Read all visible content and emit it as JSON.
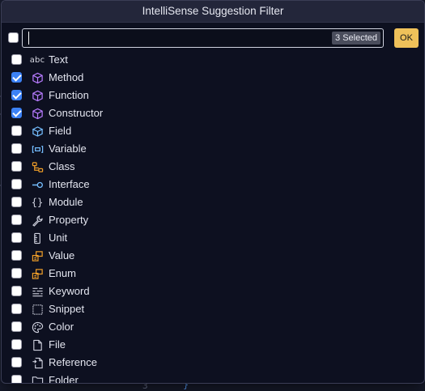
{
  "dialog": {
    "title": "IntelliSense Suggestion Filter",
    "filter_value": "",
    "selected_badge": "3 Selected",
    "ok_label": "OK",
    "select_all_checked": false
  },
  "editor_peek": {
    "line_number": "3",
    "brace": "}"
  },
  "colors": {
    "accent_ok": "#efc15a",
    "checkbox_checked": "#3c82f6",
    "method_icon": "#b77bff",
    "class_icon": "#ee9d28",
    "variable_icon": "#75beff"
  },
  "items": [
    {
      "label": "Text",
      "checked": false,
      "icon": "text-abc-icon"
    },
    {
      "label": "Method",
      "checked": true,
      "icon": "method-cube-icon"
    },
    {
      "label": "Function",
      "checked": true,
      "icon": "function-cube-icon"
    },
    {
      "label": "Constructor",
      "checked": true,
      "icon": "constructor-cube-icon"
    },
    {
      "label": "Field",
      "checked": false,
      "icon": "field-icon"
    },
    {
      "label": "Variable",
      "checked": false,
      "icon": "variable-icon"
    },
    {
      "label": "Class",
      "checked": false,
      "icon": "class-icon"
    },
    {
      "label": "Interface",
      "checked": false,
      "icon": "interface-icon"
    },
    {
      "label": "Module",
      "checked": false,
      "icon": "module-braces-icon"
    },
    {
      "label": "Property",
      "checked": false,
      "icon": "property-wrench-icon"
    },
    {
      "label": "Unit",
      "checked": false,
      "icon": "unit-ruler-icon"
    },
    {
      "label": "Value",
      "checked": false,
      "icon": "value-enum-icon"
    },
    {
      "label": "Enum",
      "checked": false,
      "icon": "enum-icon"
    },
    {
      "label": "Keyword",
      "checked": false,
      "icon": "keyword-icon"
    },
    {
      "label": "Snippet",
      "checked": false,
      "icon": "snippet-icon"
    },
    {
      "label": "Color",
      "checked": false,
      "icon": "color-palette-icon"
    },
    {
      "label": "File",
      "checked": false,
      "icon": "file-icon"
    },
    {
      "label": "Reference",
      "checked": false,
      "icon": "reference-icon"
    },
    {
      "label": "Folder",
      "checked": false,
      "icon": "folder-icon"
    }
  ]
}
